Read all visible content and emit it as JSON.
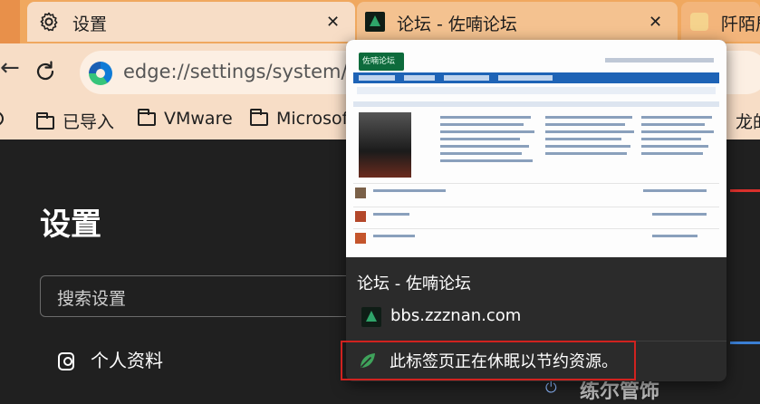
{
  "tabs": [
    {
      "title": "设置",
      "icon": "gear-icon",
      "close": "✕"
    },
    {
      "title": "论坛 - 佐喃论坛",
      "icon": "forum-favicon-icon",
      "close": "✕"
    },
    {
      "title": "阡陌居",
      "icon": "site-favicon-icon"
    }
  ],
  "toolbar": {
    "back_glyph": "←",
    "url": "edge://settings/system/ma"
  },
  "bookmarks": [
    {
      "label": "已导入"
    },
    {
      "label": "VMware"
    },
    {
      "label": "Microsoft"
    },
    {
      "label": "龙的"
    }
  ],
  "settings": {
    "title": "设置",
    "search_placeholder": "搜索设置",
    "profile_label": "个人资料"
  },
  "hover_card": {
    "title": "论坛 - 佐喃论坛",
    "domain": "bbs.zzznan.com",
    "sleeping_message": "此标签页正在休眠以节约资源。",
    "thumbnail_logo_text": "佐喃论坛"
  },
  "background_fragment": "练尔管饰"
}
